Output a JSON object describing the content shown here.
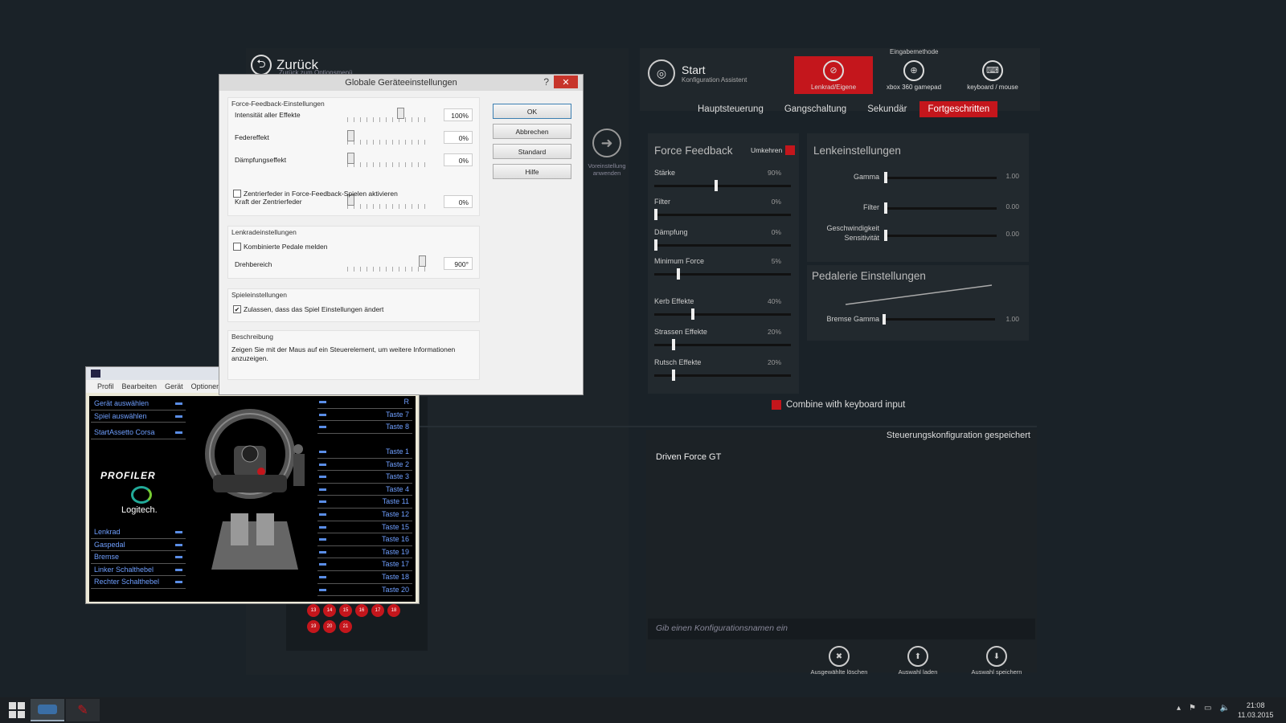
{
  "back": {
    "title": "Zurück",
    "subtitle": "Zurück zum Optionsmenü"
  },
  "app": {
    "start_title": "Start",
    "start_sub": "Konfiguration Assistent",
    "eingabe_label": "Eingabemethode",
    "methods": [
      {
        "label": "Lenkrad/Eigene",
        "icon": "steering-wheel-icon"
      },
      {
        "label": "xbox 360 gamepad",
        "icon": "gamepad-icon"
      },
      {
        "label": "keyboard / mouse",
        "icon": "keyboard-icon"
      }
    ],
    "tabs": [
      "Hauptsteuerung",
      "Gangschaltung",
      "Sekundär",
      "Fortgeschritten"
    ],
    "active_tab": "Fortgeschritten",
    "ff": {
      "title": "Force Feedback",
      "umkehren": "Umkehren",
      "sliders": [
        {
          "label": "Stärke",
          "value": "90%",
          "level": 0.45
        },
        {
          "label": "Filter",
          "value": "0%",
          "level": 0
        },
        {
          "label": "Dämpfung",
          "value": "0%",
          "level": 0
        },
        {
          "label": "Minimum Force",
          "value": "5%",
          "level": 0.17
        },
        {
          "label": "Kerb Effekte",
          "value": "40%",
          "level": 0.28
        },
        {
          "label": "Strassen Effekte",
          "value": "20%",
          "level": 0.13
        },
        {
          "label": "Rutsch Effekte",
          "value": "20%",
          "level": 0.13
        }
      ]
    },
    "lenk": {
      "title": "Lenkeinstellungen",
      "sliders": [
        {
          "label": "Gamma",
          "value": "1.00",
          "level": 0
        },
        {
          "label": "Filter",
          "value": "0.00",
          "level": 0
        },
        {
          "label": "Geschwindigkeit Sensitivität",
          "value": "0.00",
          "level": 0
        }
      ]
    },
    "pedal": {
      "title": "Pedalerie Einstellungen",
      "slider": {
        "label": "Bremse Gamma",
        "value": "1.00",
        "level": 0
      }
    },
    "combine": "Combine with keyboard input",
    "vorei": "Voreinstellung anwenden",
    "cfg": {
      "saved": "Steuerungskonfiguration gespeichert",
      "name": "Driven Force GT",
      "placeholder": "Gib einen Konfigurationsnamen ein",
      "buttons": [
        "Ausgewählte löschen",
        "Auswahl laden",
        "Auswahl speichern"
      ]
    },
    "red_buttons": [
      "13",
      "14",
      "15",
      "16",
      "17",
      "18",
      "19",
      "20",
      "21"
    ]
  },
  "dialog": {
    "title": "Globale Geräteeinstellungen",
    "help": "?",
    "close": "✕",
    "ff_group": "Force-Feedback-Einstellungen",
    "ff_rows": [
      {
        "label": "Intensität aller Effekte",
        "value": "100%",
        "level": 0.65
      },
      {
        "label": "Federeffekt",
        "value": "0%",
        "level": 0
      },
      {
        "label": "Dämpfungseffekt",
        "value": "0%",
        "level": 0
      }
    ],
    "center_spring_chk": "Zentrierfeder in Force-Feedback-Spielen aktivieren",
    "center_spring_force": {
      "label": "Kraft der Zentrierfeder",
      "value": "0%",
      "level": 0
    },
    "wheel_group": "Lenkradeinstellungen",
    "combined_pedals": "Kombinierte Pedale melden",
    "range": {
      "label": "Drehbereich",
      "value": "900°",
      "level": 0.93
    },
    "game_group": "Spieleinstellungen",
    "allow_game": "Zulassen, dass das Spiel Einstellungen ändert",
    "desc_group": "Beschreibung",
    "desc_text": "Zeigen Sie mit der Maus auf ein Steuerelement, um weitere Informationen anzuzeigen.",
    "buttons": [
      "OK",
      "Abbrechen",
      "Standard",
      "Hilfe"
    ]
  },
  "profiler": {
    "menu": [
      "Profil",
      "Bearbeiten",
      "Gerät",
      "Optionen"
    ],
    "top_list": [
      "Gerät auswählen",
      "Spiel auswählen",
      "StartAssetto Corsa"
    ],
    "brand": "PROFILER",
    "logo": "Logitech.",
    "bottom_list": [
      "Lenkrad",
      "Gaspedal",
      "Bremse",
      "Linker Schalthebel",
      "Rechter Schalthebel"
    ],
    "right_top": [
      "R",
      "Taste 7",
      "Taste 8"
    ],
    "right_list": [
      "Taste 1",
      "Taste 2",
      "Taste 3",
      "Taste 4",
      "Taste 11",
      "Taste 12",
      "Taste 15",
      "Taste 16",
      "Taste 19",
      "Taste 17",
      "Taste 18",
      "Taste 20"
    ]
  },
  "taskbar": {
    "time": "21:08",
    "date": "11.03.2015"
  }
}
